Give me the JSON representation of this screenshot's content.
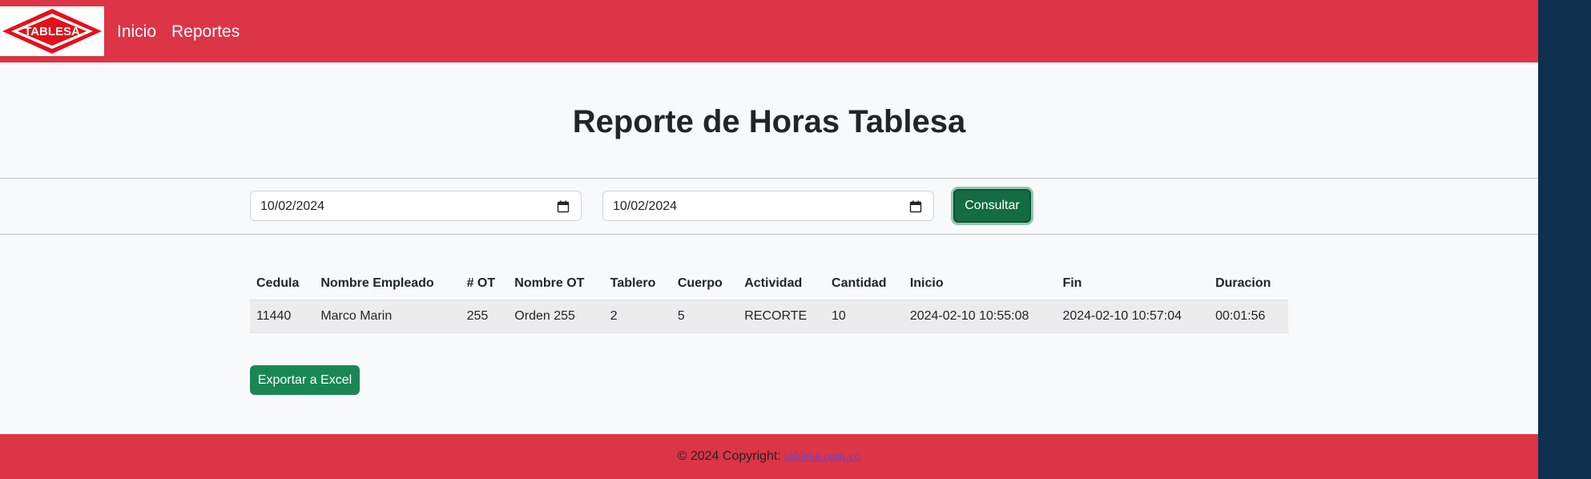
{
  "navbar": {
    "logo_text": "TABLESA",
    "links": [
      {
        "label": "Inicio"
      },
      {
        "label": "Reportes"
      }
    ]
  },
  "main": {
    "title": "Reporte de Horas Tablesa",
    "filters": {
      "start_date": "10/02/2024",
      "end_date": "10/02/2024",
      "submit_label": "Consultar"
    },
    "table": {
      "columns": [
        "Cedula",
        "Nombre Empleado",
        "# OT",
        "Nombre OT",
        "Tablero",
        "Cuerpo",
        "Actividad",
        "Cantidad",
        "Inicio",
        "Fin",
        "Duracion"
      ],
      "rows": [
        [
          "11440",
          "Marco Marin",
          "255",
          "Orden 255",
          "2",
          "5",
          "RECORTE",
          "10",
          "2024-02-10 10:55:08",
          "2024-02-10 10:57:04",
          "00:01:56"
        ]
      ]
    },
    "export_label": "Exportar a Excel"
  },
  "footer": {
    "copyright": "© 2024 Copyright:",
    "link_text": "tablesa.com.co"
  },
  "colors": {
    "brand": "#dc3545",
    "primary_button": "#198754",
    "side_panel": "#0e3150"
  },
  "icons": {
    "calendar": "calendar-icon"
  }
}
